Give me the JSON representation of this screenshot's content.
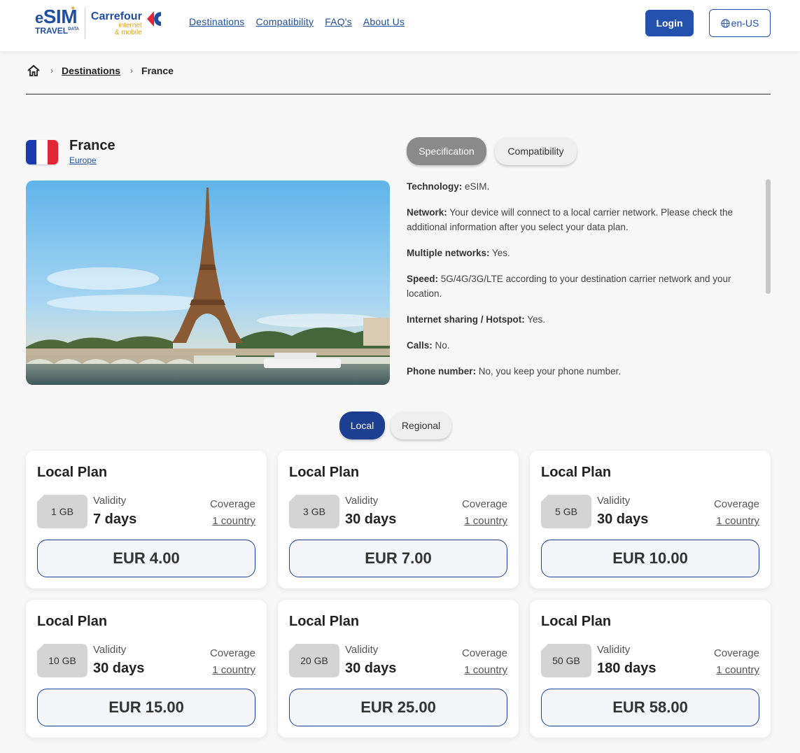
{
  "header": {
    "logo": {
      "esim_big": "SIM",
      "esim_e": "e",
      "esim_small": "TRAVEL",
      "esim_sup": "DATA",
      "carrefour": "Carrefour",
      "carrefour_sub1": "internet",
      "carrefour_sub2": "& mobile"
    },
    "nav": [
      "Destinations",
      "Compatibility",
      "FAQ's",
      "About Us"
    ],
    "login": "Login",
    "lang": "en-US"
  },
  "breadcrumb": {
    "home_icon": "home-icon",
    "link": "Destinations",
    "current": "France"
  },
  "country": {
    "name": "France",
    "region": "Europe",
    "flag_colors": [
      "#1a3bb0",
      "#ffffff",
      "#e32636"
    ]
  },
  "tabs": {
    "specification": "Specification",
    "compatibility": "Compatibility"
  },
  "specs": [
    {
      "label": "Technology:",
      "value": "eSIM."
    },
    {
      "label": "Network:",
      "value": "Your device will connect to a local carrier network. Please check the additional information after you select your data plan."
    },
    {
      "label": "Multiple networks:",
      "value": "Yes."
    },
    {
      "label": "Speed:",
      "value": "5G/4G/3G/LTE according to your destination carrier network and your location."
    },
    {
      "label": "Internet sharing / Hotspot:",
      "value": "Yes."
    },
    {
      "label": "Calls:",
      "value": "No."
    },
    {
      "label": "Phone number:",
      "value": "No, you keep your phone number."
    }
  ],
  "plan_tabs": {
    "local": "Local",
    "regional": "Regional"
  },
  "labels": {
    "validity": "Validity",
    "coverage": "Coverage"
  },
  "plans": [
    {
      "title": "Local Plan",
      "data": "1 GB",
      "validity": "7 days",
      "coverage": "1 country",
      "price": "EUR 4.00"
    },
    {
      "title": "Local Plan",
      "data": "3 GB",
      "validity": "30 days",
      "coverage": "1 country",
      "price": "EUR 7.00"
    },
    {
      "title": "Local Plan",
      "data": "5 GB",
      "validity": "30 days",
      "coverage": "1 country",
      "price": "EUR 10.00"
    },
    {
      "title": "Local Plan",
      "data": "10 GB",
      "validity": "30 days",
      "coverage": "1 country",
      "price": "EUR 15.00"
    },
    {
      "title": "Local Plan",
      "data": "20 GB",
      "validity": "30 days",
      "coverage": "1 country",
      "price": "EUR 25.00"
    },
    {
      "title": "Local Plan",
      "data": "50 GB",
      "validity": "180 days",
      "coverage": "1 country",
      "price": "EUR 58.00"
    }
  ],
  "colors": {
    "brand": "#1f4ea3",
    "accent": "#e3a21a",
    "active_tab": "#1d3f91"
  }
}
